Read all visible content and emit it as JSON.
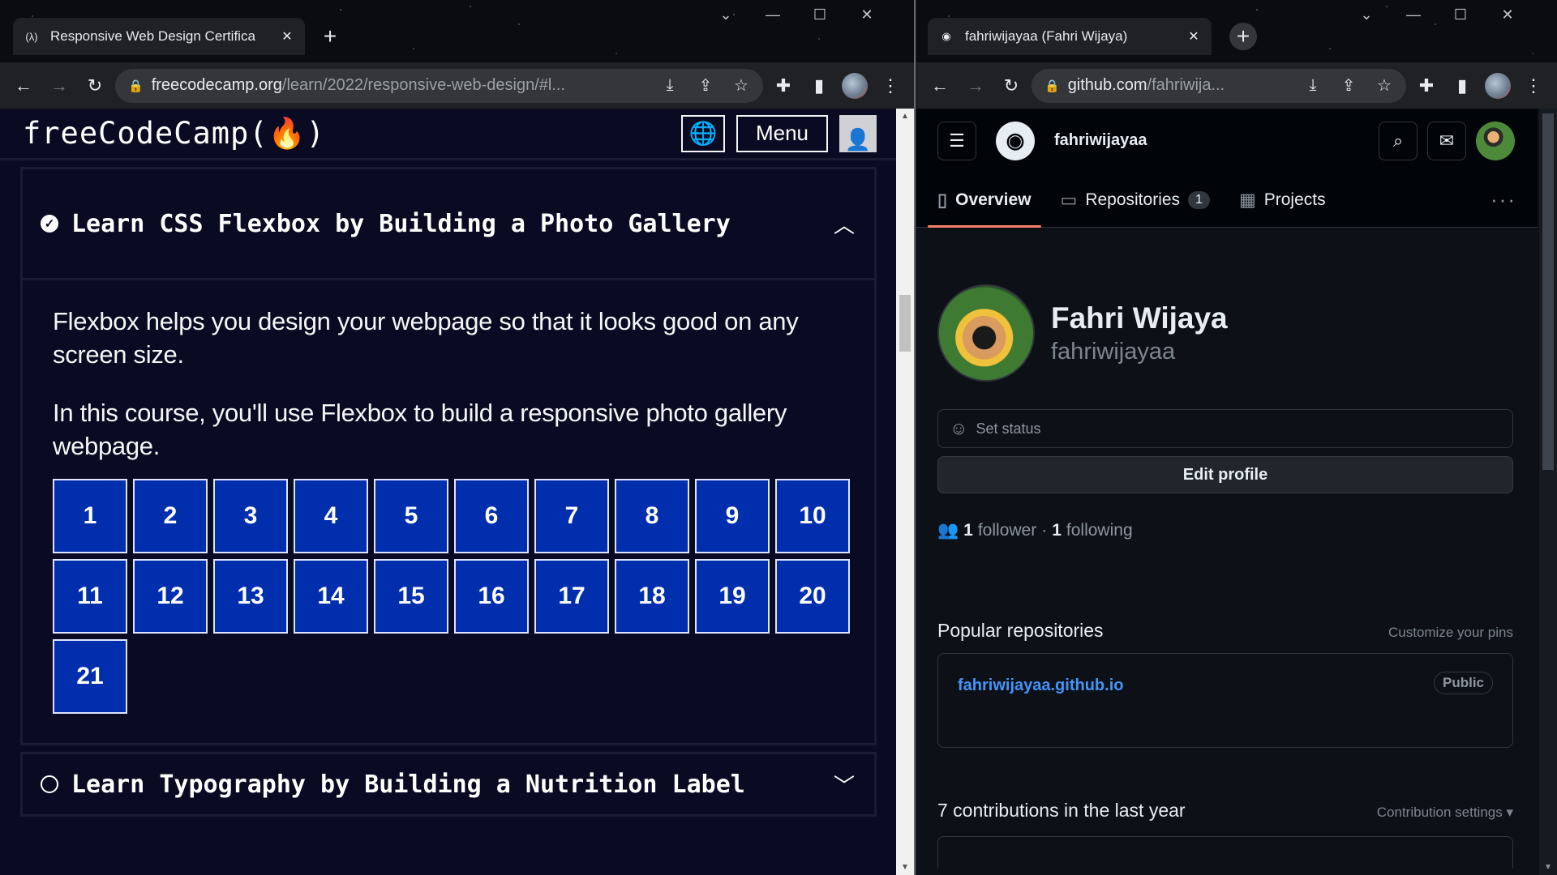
{
  "left_browser": {
    "tab_title": "Responsive Web Design Certifica",
    "tab_favicon": "(λ)",
    "tab_close": "✕",
    "new_tab": "+",
    "window_controls": [
      "⌄",
      "—",
      "☐",
      "✕"
    ],
    "url_host": "freecodecamp.org",
    "url_path": "/learn/2022/responsive-web-design/#l...",
    "nav_icons": [
      "back-icon",
      "forward-icon",
      "reload-icon"
    ],
    "omnibox_icons": [
      "download-icon",
      "share-icon",
      "star-icon"
    ],
    "toolbar_icons": [
      "extensions-icon",
      "sidepanel-icon",
      "profile-avatar",
      "menu-icon"
    ]
  },
  "fcc": {
    "logo": "freeCodeCamp(🔥)",
    "menu_label": "Menu",
    "block1": {
      "title": "Learn CSS Flexbox by Building a Photo Gallery",
      "para1": "Flexbox helps you design your webpage so that it looks good on any screen size.",
      "para2": "In this course, you'll use Flexbox to build a responsive photo gallery webpage.",
      "steps": [
        "1",
        "2",
        "3",
        "4",
        "5",
        "6",
        "7",
        "8",
        "9",
        "10",
        "11",
        "12",
        "13",
        "14",
        "15",
        "16",
        "17",
        "18",
        "19",
        "20",
        "21"
      ]
    },
    "block2": {
      "title": "Learn Typography by Building a Nutrition Label"
    },
    "colors": {
      "bg": "#0a0a23",
      "step": "#002ead",
      "panel": "#1b1b32"
    }
  },
  "right_browser": {
    "tab_title": "fahriwijayaa (Fahri Wijaya)",
    "tab_close": "✕",
    "new_tab": "+",
    "window_controls": [
      "⌄",
      "—",
      "☐",
      "✕"
    ],
    "url_host": "github.com",
    "url_path": "/fahriwija..."
  },
  "github": {
    "header_user": "fahriwijayaa",
    "tabs": [
      {
        "label": "Overview",
        "icon": "book-icon"
      },
      {
        "label": "Repositories",
        "icon": "repo-icon",
        "count": "1"
      },
      {
        "label": "Projects",
        "icon": "table-icon"
      }
    ],
    "full_name": "Fahri Wijaya",
    "login": "fahriwijayaa",
    "status_placeholder": "Set status",
    "edit_profile": "Edit profile",
    "followers_count": "1",
    "followers_label": "follower",
    "separator": "·",
    "following_count": "1",
    "following_label": "following",
    "popular_title": "Popular repositories",
    "customize_pins": "Customize your pins",
    "repo_name": "fahriwijayaa.github.io",
    "repo_visibility": "Public",
    "contrib_title": "7 contributions in the last year",
    "contrib_settings": "Contribution settings ▾",
    "colors": {
      "bg": "#0d1117",
      "link": "#4493f8",
      "underline": "#f78166"
    }
  }
}
